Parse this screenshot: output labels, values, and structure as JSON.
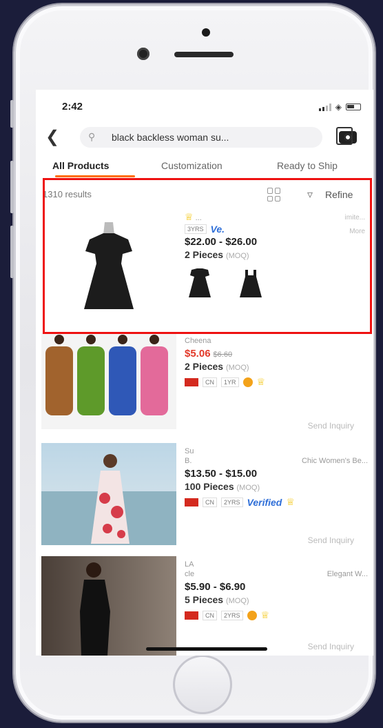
{
  "status": {
    "time": "2:42"
  },
  "search": {
    "query": "black backless woman su..."
  },
  "tabs": [
    {
      "label": "All Products",
      "active": true
    },
    {
      "label": "Customization",
      "active": false
    },
    {
      "label": "Ready to Ship",
      "active": false
    }
  ],
  "results": {
    "count": "1310 results",
    "refine": "Refine"
  },
  "products": [
    {
      "supplier": "...",
      "supplier_right": "imite...",
      "more": "More",
      "years": "3YRS",
      "verified": "Ve.",
      "price": "$22.00 - $26.00",
      "moq_qty": "2 Pieces",
      "moq_label": "(MOQ)"
    },
    {
      "supplier": "Cheena",
      "price": "$5.06",
      "old_price": "$6.60",
      "moq_qty": "2 Pieces",
      "moq_label": "(MOQ)",
      "country": "CN",
      "years": "1YR",
      "inquiry": "Send Inquiry"
    },
    {
      "supplier": "Su",
      "supplier_line2": "B.",
      "supplier_right": "Chic Women's Be...",
      "price": "$13.50 - $15.00",
      "moq_qty": "100 Pieces",
      "moq_label": "(MOQ)",
      "country": "CN",
      "years": "2YRS",
      "verified": "Verified",
      "inquiry": "Send Inquiry"
    },
    {
      "supplier": "LA",
      "supplier_line2": "cle",
      "supplier_right": "Elegant W...",
      "price": "$5.90 - $6.90",
      "moq_qty": "5 Pieces",
      "moq_label": "(MOQ)",
      "country": "CN",
      "years": "2YRS",
      "inquiry": "Send Inquiry"
    }
  ],
  "colors": {
    "accent": "#ff6a00",
    "highlight": "#ee1111",
    "price_red": "#e23a2a",
    "verified_blue": "#2f6fd8"
  }
}
